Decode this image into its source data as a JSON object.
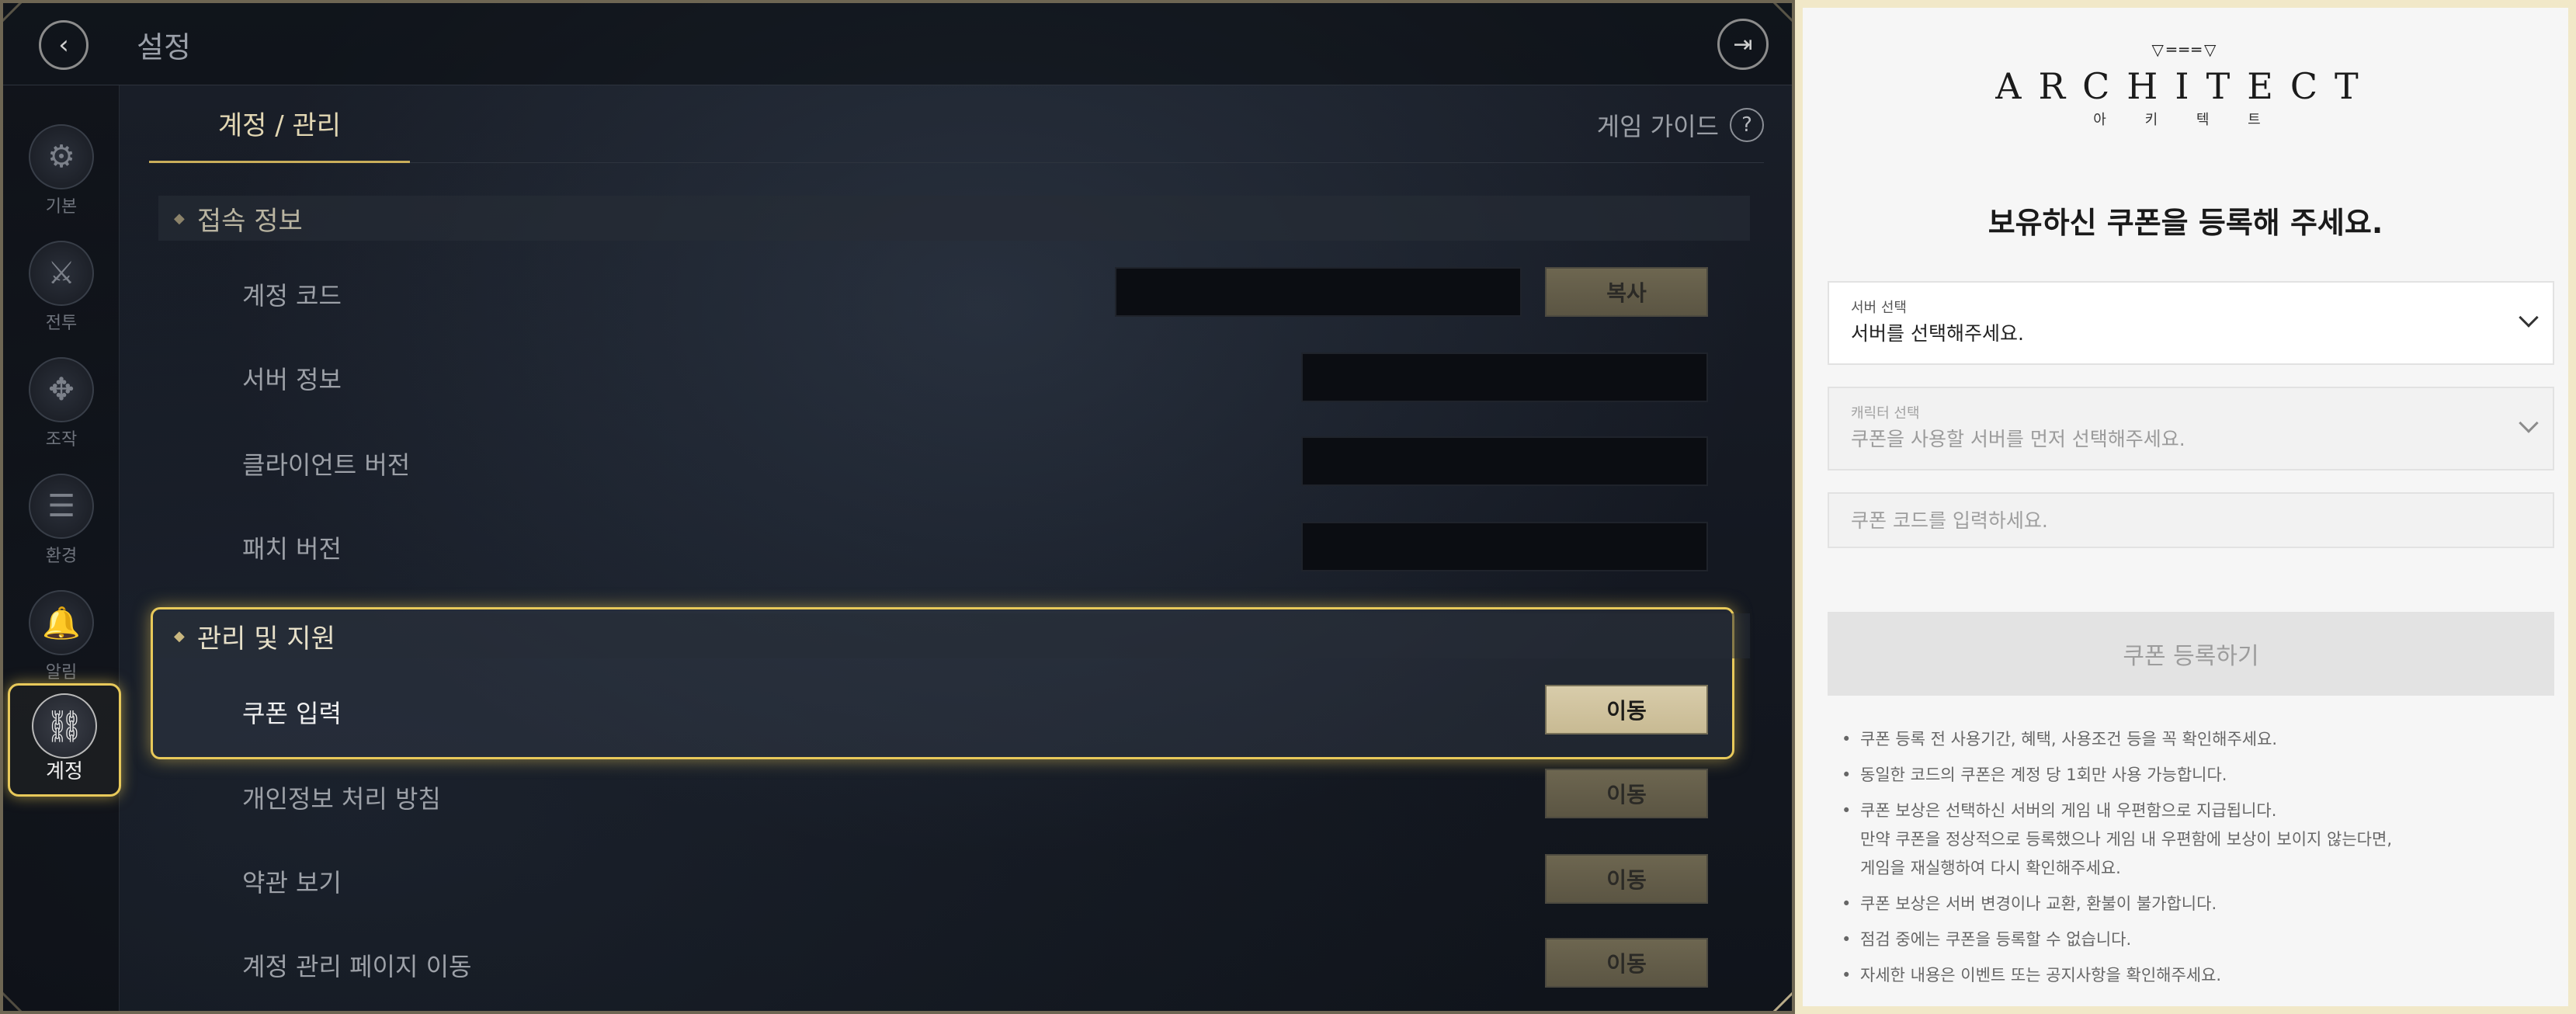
{
  "game": {
    "title": "설정",
    "tabs": [
      {
        "label": "계정 / 관리"
      }
    ],
    "guide_label": "게임 가이드",
    "guide_icon_text": "?",
    "sidebar": [
      {
        "label": "기본",
        "icon": "gear-icon",
        "glyph": "⚙"
      },
      {
        "label": "전투",
        "icon": "crossed-swords-icon",
        "glyph": "⚔"
      },
      {
        "label": "조작",
        "icon": "gamepad-icon",
        "glyph": "✥"
      },
      {
        "label": "환경",
        "icon": "sliders-icon",
        "glyph": "☰"
      },
      {
        "label": "알림",
        "icon": "bell-icon",
        "glyph": "🔔"
      },
      {
        "label": "계정",
        "icon": "link-icon",
        "glyph": "⛓",
        "active": true
      }
    ],
    "sections": [
      {
        "title": "접속 정보",
        "rows": [
          {
            "label": "계정 코드",
            "button": "복사"
          },
          {
            "label": "서버 정보"
          },
          {
            "label": "클라이언트 버전"
          },
          {
            "label": "패치 버전"
          }
        ]
      },
      {
        "title": "관리 및 지원",
        "rows": [
          {
            "label": "쿠폰 입력",
            "button": "이동"
          },
          {
            "label": "개인정보 처리 방침",
            "button": "이동"
          },
          {
            "label": "약관 보기",
            "button": "이동"
          },
          {
            "label": "계정 관리 페이지 이동",
            "button": "이동"
          }
        ]
      }
    ]
  },
  "coupon": {
    "logo_text": "ARCHITECT",
    "logo_sub": "아 키 텍 트",
    "title": "보유하신 쿠폰을 등록해 주세요.",
    "server_select": {
      "small_label": "서버 선택",
      "value": "서버를 선택해주세요."
    },
    "character_select": {
      "small_label": "캐릭터 선택",
      "value": "쿠폰을 사용할 서버를 먼저 선택해주세요."
    },
    "code_placeholder": "쿠폰 코드를 입력하세요.",
    "register_label": "쿠폰 등록하기",
    "notes": [
      "쿠폰 등록 전 사용기간, 혜택, 사용조건 등을 꼭 확인해주세요.",
      "동일한 코드의 쿠폰은 계정 당 1회만 사용 가능합니다.",
      "쿠폰 보상은 선택하신 서버의 게임 내 우편함으로 지급됩니다.",
      "만약 쿠폰을 정상적으로 등록했으나 게임 내 우편함에 보상이 보이지 않는다면,",
      "게임을 재실행하여 다시 확인해주세요.",
      "쿠폰 보상은 서버 변경이나 교환, 환불이 불가합니다.",
      "점검 중에는 쿠폰을 등록할 수 없습니다.",
      "자세한 내용은 이벤트 또는 공지사항을 확인해주세요."
    ]
  }
}
